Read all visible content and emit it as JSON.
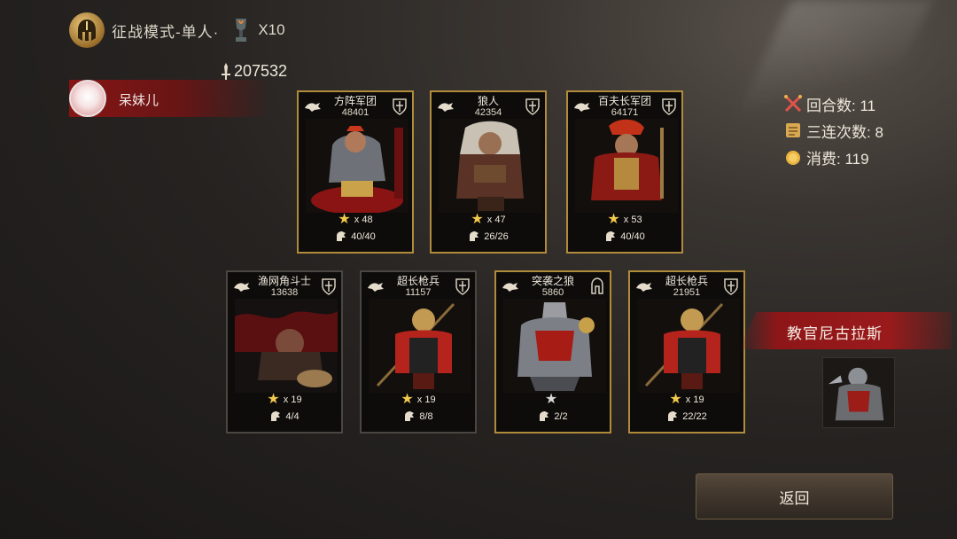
{
  "header": {
    "mode_title": "征战模式-单人·",
    "multiplier": "X10",
    "icon": "helmet-icon",
    "trophy_icon": "trophy-icon"
  },
  "power_total": "207532",
  "player": {
    "name": "呆妹儿"
  },
  "stats": [
    {
      "icon": "crossed-swords-icon",
      "label": "回合数: 11"
    },
    {
      "icon": "scroll-icon",
      "label": "三连次数: 8"
    },
    {
      "icon": "coin-icon",
      "label": "消费: 119"
    }
  ],
  "cards": [
    {
      "name": "方阵军团",
      "power": "48401",
      "stars": "x 48",
      "troops": "40/40",
      "class": "shield"
    },
    {
      "name": "狼人",
      "power": "42354",
      "stars": "x 47",
      "troops": "26/26",
      "class": "shield"
    },
    {
      "name": "百夫长军团",
      "power": "64171",
      "stars": "x 53",
      "troops": "40/40",
      "class": "shield"
    },
    {
      "name": "渔网角斗士",
      "power": "13638",
      "stars": "x 19",
      "troops": "4/4",
      "class": "shield"
    },
    {
      "name": "超长枪兵",
      "power": "11157",
      "stars": "x 19",
      "troops": "8/8",
      "class": "shield"
    },
    {
      "name": "突袭之狼",
      "power": "5860",
      "stars": "",
      "troops": "2/2",
      "class": "helmet"
    },
    {
      "name": "超长枪兵",
      "power": "21951",
      "stars": "x 19",
      "troops": "22/22",
      "class": "shield"
    }
  ],
  "instructor": {
    "name": "教官尼古拉斯"
  },
  "back_label": "返回",
  "colors": {
    "gold_border": "#b08b3c",
    "banner_red": "#8e1618",
    "star_gold": "#f2c94c"
  }
}
